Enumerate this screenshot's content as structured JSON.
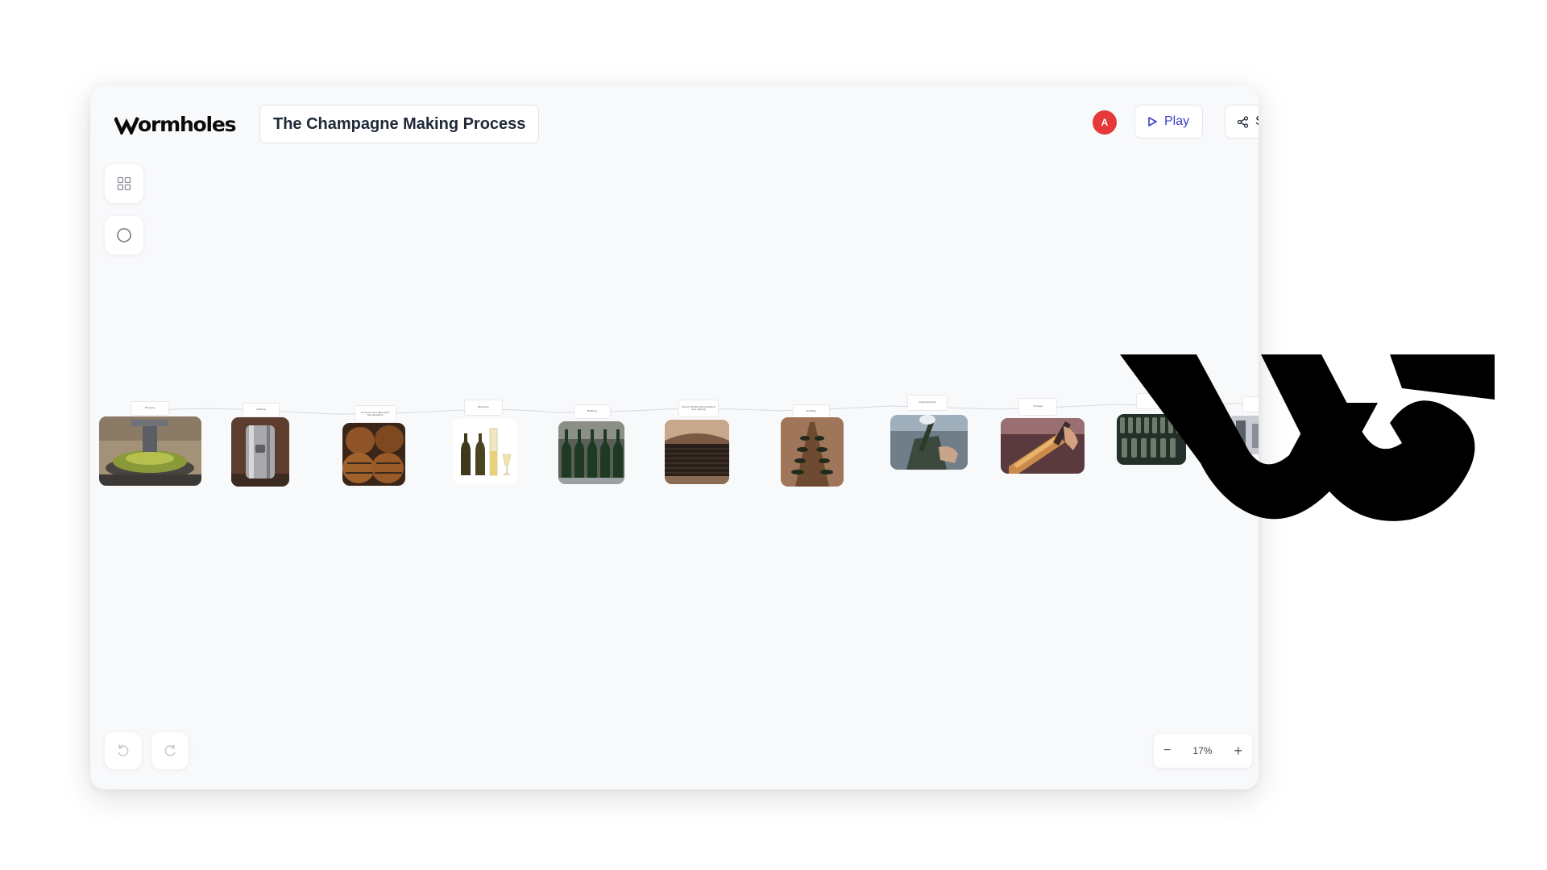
{
  "app": {
    "logo_text": "ormholes",
    "brand": "Wormholes"
  },
  "header": {
    "title": "The Champagne Making Process",
    "avatar_initial": "A",
    "play_label": "Play",
    "share_label": "S"
  },
  "toolbar": {
    "grid_icon": "grid-icon",
    "circle_icon": "circle-icon"
  },
  "history": {
    "undo_icon": "undo-icon",
    "redo_icon": "redo-icon"
  },
  "zoom": {
    "value": "17%",
    "minus": "−",
    "plus": "+"
  },
  "nodes": [
    {
      "label": "Pressing"
    },
    {
      "label": "Settling"
    },
    {
      "label": "Alcoholic and Malolactic Fermentation"
    },
    {
      "label": "Blending"
    },
    {
      "label": "Bottling"
    },
    {
      "label": "Second Bottle Fermentation and Ageing"
    },
    {
      "label": "Riddling"
    },
    {
      "label": "Disgorgement"
    },
    {
      "label": "Dosage"
    },
    {
      "label": ""
    },
    {
      "label": ""
    }
  ],
  "colors": {
    "accent": "#3b3fc4",
    "avatar": "#e5383b",
    "canvas": "#f8f9fb"
  }
}
